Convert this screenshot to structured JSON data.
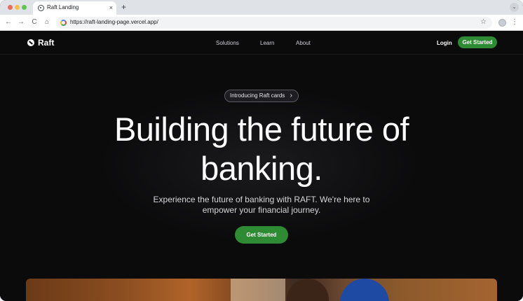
{
  "browser": {
    "tab_title": "Raft Landing",
    "tab_close": "×",
    "new_tab": "+",
    "menu_chevron": "⌄",
    "back": "←",
    "forward": "→",
    "reload": "C",
    "home": "⌂",
    "url": "https://raft-landing-page.vercel.app/",
    "bookmark_star": "☆",
    "kebab": "⋮"
  },
  "nav": {
    "logo_text": "Raft",
    "links": [
      "Solutions",
      "Learn",
      "About"
    ],
    "login": "Login",
    "cta": "Get Started"
  },
  "hero": {
    "pill": "Introducing Raft cards",
    "pill_chevron": "›",
    "headline_line1": "Building the future of",
    "headline_line2": "banking.",
    "subtext_line1": "Experience the future of banking with RAFT. We're here to",
    "subtext_line2": "empower your financial journey.",
    "cta": "Get Started"
  },
  "colors": {
    "page_background": "#0b0b0c",
    "accent_green": "#2e8b33",
    "text_primary": "#ffffff",
    "text_secondary": "#d6d6da"
  }
}
